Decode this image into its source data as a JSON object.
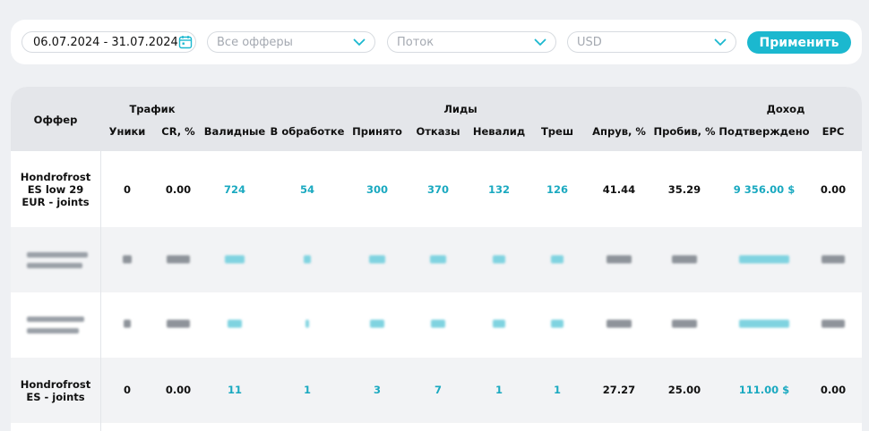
{
  "filters": {
    "date_range": "06.07.2024 - 31.07.2024",
    "offers_placeholder": "Все офферы",
    "flow_placeholder": "Поток",
    "currency_placeholder": "USD",
    "apply_label": "Применить"
  },
  "colors": {
    "accent": "#1bb8cf",
    "link": "#1aa9c0",
    "header_bg": "#e4e6ea"
  },
  "table": {
    "offer_header": "Оффер",
    "groups": {
      "traffic": "Трафик",
      "leads": "Лиды",
      "income": "Доход"
    },
    "columns": [
      "Уники",
      "CR, %",
      "Валидные",
      "В обработке",
      "Принято",
      "Отказы",
      "Невалид",
      "Треш",
      "Апрув, %",
      "Пробив, %",
      "Подтверждено",
      "EPC"
    ],
    "rows": [
      {
        "offer": "Hondrofrost ES low 29 EUR - joints",
        "values": [
          "0",
          "0.00",
          "724",
          "54",
          "300",
          "370",
          "132",
          "126",
          "41.44",
          "35.29",
          "9 356.00 $",
          "0.00"
        ]
      },
      {
        "offer": "",
        "values": []
      },
      {
        "offer": "",
        "values": []
      },
      {
        "offer": "Hondrofrost ES - joints",
        "values": [
          "0",
          "0.00",
          "11",
          "1",
          "3",
          "7",
          "1",
          "1",
          "27.27",
          "25.00",
          "111.00 $",
          "0.00"
        ]
      }
    ]
  }
}
